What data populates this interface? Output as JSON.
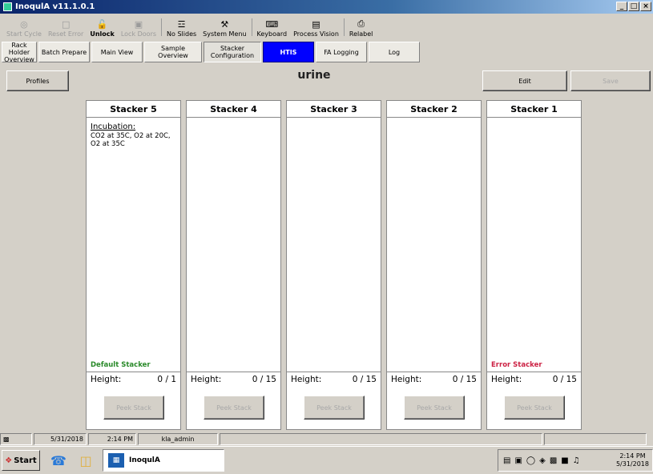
{
  "window": {
    "title": "InoqulA v11.1.0.1",
    "controls": [
      "_",
      "□",
      "×"
    ]
  },
  "toolbar": [
    {
      "label": "Start Cycle",
      "icon": "◎",
      "icon_name": "start-cycle-icon",
      "enabled": false
    },
    {
      "label": "Reset Error",
      "icon": "□",
      "icon_name": "reset-icon",
      "enabled": false
    },
    {
      "label": "Unlock",
      "icon": "🔓",
      "icon_name": "unlock-icon",
      "enabled": true,
      "bold": true
    },
    {
      "label": "Lock Doors",
      "icon": "▣",
      "icon_name": "lock-doors-icon",
      "enabled": false
    },
    {
      "label": "No Slides",
      "icon": "☲",
      "icon_name": "slides-icon",
      "enabled": true
    },
    {
      "label": "System Menu",
      "icon": "⚒",
      "icon_name": "system-menu-icon",
      "enabled": true
    },
    {
      "label": "Keyboard",
      "icon": "⌨",
      "icon_name": "keyboard-icon",
      "enabled": true
    },
    {
      "label": "Process Vision",
      "icon": "▤",
      "icon_name": "process-vision-icon",
      "enabled": true
    },
    {
      "label": "Relabel",
      "icon": "⎙",
      "icon_name": "printer-icon",
      "enabled": true
    }
  ],
  "nav_tabs": [
    {
      "label": "Rack Holder Overview",
      "width": 44
    },
    {
      "label": "Batch Prepare",
      "width": 64
    },
    {
      "label": "Main View",
      "width": 64
    },
    {
      "label": "Sample Overview",
      "width": 72
    },
    {
      "label": "Stacker Configuration",
      "width": 72,
      "state": "pressed"
    },
    {
      "label": "HTIS",
      "width": 64,
      "state": "active"
    },
    {
      "label": "FA Logging",
      "width": 64
    },
    {
      "label": "Log",
      "width": 64
    }
  ],
  "profiles_button": "Profiles",
  "profile_name": "urine",
  "edit_button": "Edit",
  "save_button": "Save",
  "stackers": [
    {
      "title": "Stacker 5",
      "incubation_title": "Incubation:",
      "incubation_text": "CO2 at 35C, O2 at 20C, O2 at 35C",
      "status_label": "Default Stacker",
      "status_type": "default",
      "height_label": "Height:",
      "height_value": "0 / 1",
      "peek_button": "Peek Stack"
    },
    {
      "title": "Stacker 4",
      "incubation_title": "",
      "incubation_text": "",
      "status_label": "",
      "status_type": "",
      "height_label": "Height:",
      "height_value": "0 / 15",
      "peek_button": "Peek Stack"
    },
    {
      "title": "Stacker 3",
      "incubation_title": "",
      "incubation_text": "",
      "status_label": "",
      "status_type": "",
      "height_label": "Height:",
      "height_value": "0 / 15",
      "peek_button": "Peek Stack"
    },
    {
      "title": "Stacker 2",
      "incubation_title": "",
      "incubation_text": "",
      "status_label": "",
      "status_type": "",
      "height_label": "Height:",
      "height_value": "0 / 15",
      "peek_button": "Peek Stack"
    },
    {
      "title": "Stacker 1",
      "incubation_title": "",
      "incubation_text": "",
      "status_label": "Error Stacker",
      "status_type": "error",
      "height_label": "Height:",
      "height_value": "0 / 15",
      "peek_button": "Peek Stack"
    }
  ],
  "statusbar": {
    "date": "5/31/2018",
    "time": "2:14 PM",
    "user": "kla_admin"
  },
  "taskbar": {
    "start_label": "Start",
    "task_label": "InoqulA",
    "clock_time": "2:14 PM",
    "clock_date": "5/31/2018"
  },
  "colors": {
    "active_tab": "#0000ff",
    "default_stacker": "#2a8a2a",
    "error_stacker": "#cc2244",
    "titlebar": "#0a246a"
  }
}
